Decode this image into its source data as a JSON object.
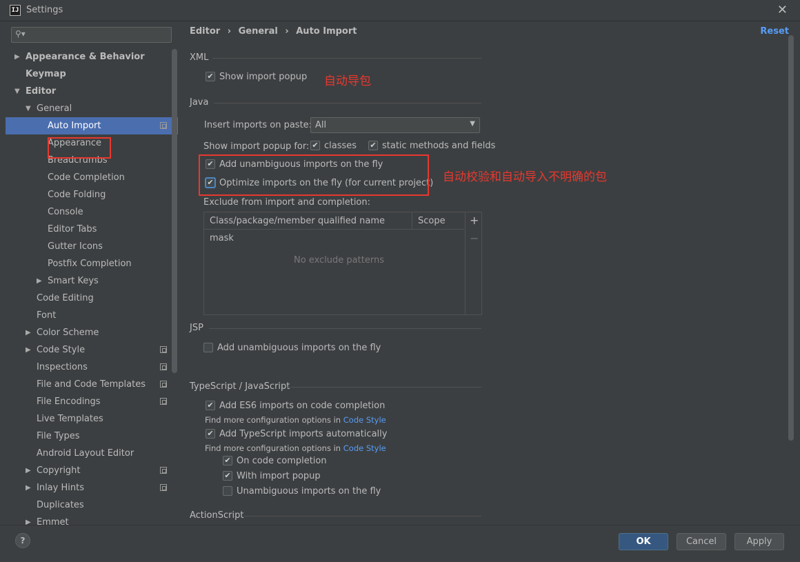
{
  "window": {
    "title": "Settings",
    "app_icon_text": "IJ"
  },
  "search": {
    "placeholder": ""
  },
  "breadcrumb": [
    "Editor",
    "General",
    "Auto Import"
  ],
  "reset_label": "Reset",
  "tree": [
    {
      "label": "Appearance & Behavior",
      "bold": true,
      "arrow": "▶"
    },
    {
      "label": "Keymap",
      "bold": true
    },
    {
      "label": "Editor",
      "bold": true,
      "arrow": "▼"
    },
    {
      "label": "General",
      "arrow": "▼"
    },
    {
      "label": "Auto Import",
      "selected": true,
      "copy": true
    },
    {
      "label": "Appearance"
    },
    {
      "label": "Breadcrumbs"
    },
    {
      "label": "Code Completion"
    },
    {
      "label": "Code Folding"
    },
    {
      "label": "Console"
    },
    {
      "label": "Editor Tabs"
    },
    {
      "label": "Gutter Icons"
    },
    {
      "label": "Postfix Completion"
    },
    {
      "label": "Smart Keys",
      "arrow": "▶"
    },
    {
      "label": "Code Editing"
    },
    {
      "label": "Font"
    },
    {
      "label": "Color Scheme",
      "arrow": "▶"
    },
    {
      "label": "Code Style",
      "arrow": "▶",
      "copy": true
    },
    {
      "label": "Inspections",
      "copy": true
    },
    {
      "label": "File and Code Templates",
      "copy": true
    },
    {
      "label": "File Encodings",
      "copy": true
    },
    {
      "label": "Live Templates"
    },
    {
      "label": "File Types"
    },
    {
      "label": "Android Layout Editor"
    },
    {
      "label": "Copyright",
      "arrow": "▶",
      "copy": true
    },
    {
      "label": "Inlay Hints",
      "arrow": "▶",
      "copy": true
    },
    {
      "label": "Duplicates"
    },
    {
      "label": "Emmet",
      "arrow": "▶"
    }
  ],
  "xml": {
    "title": "XML",
    "show_import_popup": "Show import popup",
    "annotation": "自动导包"
  },
  "java": {
    "title": "Java",
    "insert_label": "Insert imports on paste:",
    "insert_value": "All",
    "popup_for_label": "Show import popup for:",
    "classes": "classes",
    "static_methods": "static methods and fields",
    "add_unambiguous": "Add unambiguous imports on the fly",
    "optimize": "Optimize imports on the fly (for current project)",
    "annotation": "自动校验和自动导入不明确的包",
    "exclude_label": "Exclude from import and completion:",
    "col_mask": "Class/package/member qualified name mask",
    "col_scope": "Scope",
    "empty": "No exclude patterns",
    "add": "+",
    "remove": "−"
  },
  "jsp": {
    "title": "JSP",
    "add_unambiguous": "Add unambiguous imports on the fly"
  },
  "ts": {
    "title": "TypeScript / JavaScript",
    "es6": "Add ES6 imports on code completion",
    "find_more": "Find more configuration options in",
    "code_style": "Code Style",
    "ts_auto": "Add TypeScript imports automatically",
    "on_completion": "On code completion",
    "with_popup": "With import popup",
    "unambiguous": "Unambiguous imports on the fly"
  },
  "actionscript": {
    "title": "ActionScript"
  },
  "footer": {
    "help": "?",
    "ok": "OK",
    "cancel": "Cancel",
    "apply": "Apply"
  },
  "colors": {
    "selection": "#4b6eaf",
    "link": "#589df6",
    "annotation": "#e8382f",
    "ok_button": "#365880"
  }
}
